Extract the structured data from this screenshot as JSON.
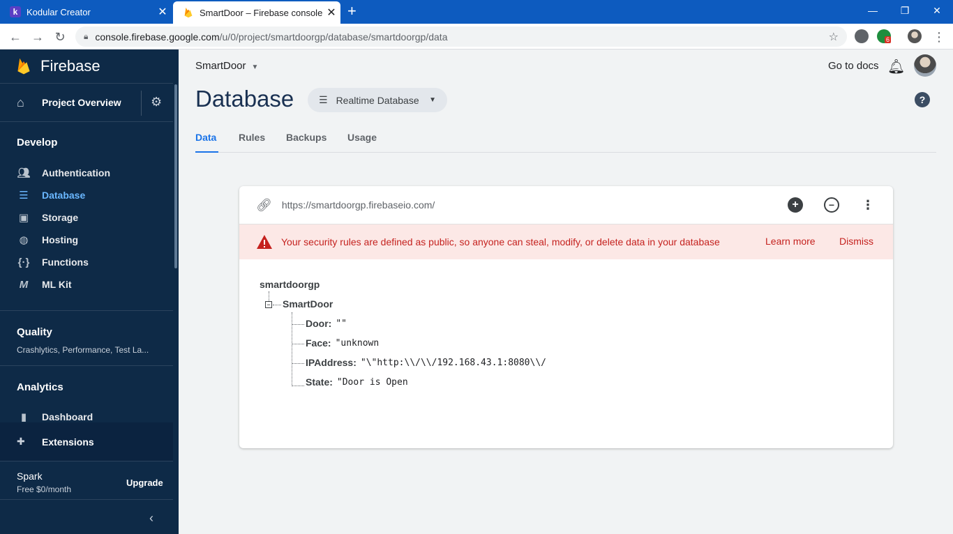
{
  "browser": {
    "tabs": [
      {
        "title": "Kodular Creator",
        "favicon": "kodular-icon"
      },
      {
        "title": "SmartDoor – Firebase console",
        "favicon": "firebase-icon"
      }
    ],
    "url_host": "console.firebase.google.com",
    "url_path": "/u/0/project/smartdoorgp/database/smartdoorgp/data",
    "extension_badge": "6"
  },
  "sidebar": {
    "brand": "Firebase",
    "project_overview": "Project Overview",
    "develop": {
      "title": "Develop",
      "items": [
        {
          "label": "Authentication",
          "icon": "people-icon"
        },
        {
          "label": "Database",
          "icon": "database-icon",
          "active": true
        },
        {
          "label": "Storage",
          "icon": "image-icon"
        },
        {
          "label": "Hosting",
          "icon": "globe-icon"
        },
        {
          "label": "Functions",
          "icon": "functions-icon"
        },
        {
          "label": "ML Kit",
          "icon": "mlkit-icon"
        }
      ]
    },
    "quality": {
      "title": "Quality",
      "subtitle": "Crashlytics, Performance, Test La..."
    },
    "analytics": {
      "title": "Analytics",
      "items": [
        {
          "label": "Dashboard",
          "icon": "bar-chart-icon"
        }
      ]
    },
    "extensions": "Extensions",
    "plan": {
      "name": "Spark",
      "price": "Free $0/month",
      "upgrade": "Upgrade"
    }
  },
  "header": {
    "project": "SmartDoor",
    "docs": "Go to docs",
    "title": "Database",
    "db_type": "Realtime Database"
  },
  "tabs": [
    "Data",
    "Rules",
    "Backups",
    "Usage"
  ],
  "card": {
    "url": "https://smartdoorgp.firebaseio.com/",
    "alert": {
      "text": "Your security rules are defined as public, so anyone can steal, modify, or delete data in your database",
      "learn_more": "Learn more",
      "dismiss": "Dismiss"
    },
    "tree": {
      "root": "smartdoorgp",
      "child": "SmartDoor",
      "fields": [
        {
          "key": "Door:",
          "value": "\"\""
        },
        {
          "key": "Face:",
          "value": "\"unknown"
        },
        {
          "key": "IPAddress:",
          "value": "\"\\\"http:\\\\/\\\\/192.168.43.1:8080\\\\/"
        },
        {
          "key": "State:",
          "value": "\"Door is Open"
        }
      ]
    }
  },
  "colors": {
    "accent": "#1a73e8",
    "sidebar": "#0e2a47",
    "alert_bg": "#fce8e6",
    "alert_text": "#c5221f"
  }
}
